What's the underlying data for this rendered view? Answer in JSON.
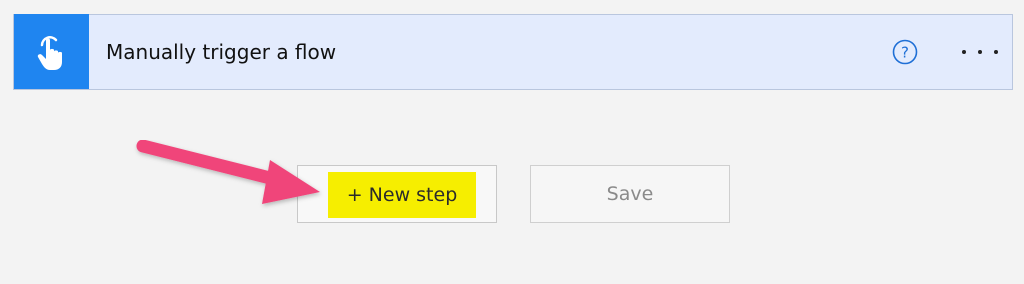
{
  "trigger": {
    "title": "Manually trigger a flow",
    "icon": "touch-hand-icon",
    "help_icon": "help-circle-icon",
    "more_icon": "more-ellipsis-icon",
    "accent_color": "#1f85f0",
    "card_color": "#e3ebfd"
  },
  "actions": {
    "new_step_label": "+ New step",
    "save_label": "Save",
    "highlight_color": "#f6ee00"
  },
  "annotation": {
    "arrow_color": "#f0457a"
  }
}
